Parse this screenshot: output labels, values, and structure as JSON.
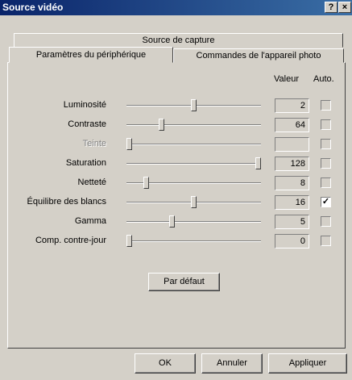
{
  "window": {
    "title": "Source vidéo",
    "help_label": "?",
    "close_label": "×"
  },
  "tabs": {
    "back_row": "Source de capture",
    "active": "Paramètres du périphérique",
    "inactive": "Commandes de l'appareil photo"
  },
  "columns": {
    "value": "Valeur",
    "auto": "Auto."
  },
  "rows": [
    {
      "label": "Luminosité",
      "value": "2",
      "auto": false,
      "enabled": true,
      "level": 0.5
    },
    {
      "label": "Contraste",
      "value": "64",
      "auto": false,
      "enabled": true,
      "level": 0.25
    },
    {
      "label": "Teinte",
      "value": "",
      "auto": false,
      "enabled": false,
      "level": 0.0
    },
    {
      "label": "Saturation",
      "value": "128",
      "auto": false,
      "enabled": true,
      "level": 1.0
    },
    {
      "label": "Netteté",
      "value": "8",
      "auto": false,
      "enabled": true,
      "level": 0.13
    },
    {
      "label": "Équilibre des blancs",
      "value": "16",
      "auto": true,
      "enabled": true,
      "level": 0.5
    },
    {
      "label": "Gamma",
      "value": "5",
      "auto": false,
      "enabled": true,
      "level": 0.33
    },
    {
      "label": "Comp. contre-jour",
      "value": "0",
      "auto": false,
      "enabled": true,
      "level": 0.0
    }
  ],
  "buttons": {
    "default": "Par défaut",
    "ok": "OK",
    "cancel": "Annuler",
    "apply": "Appliquer"
  }
}
